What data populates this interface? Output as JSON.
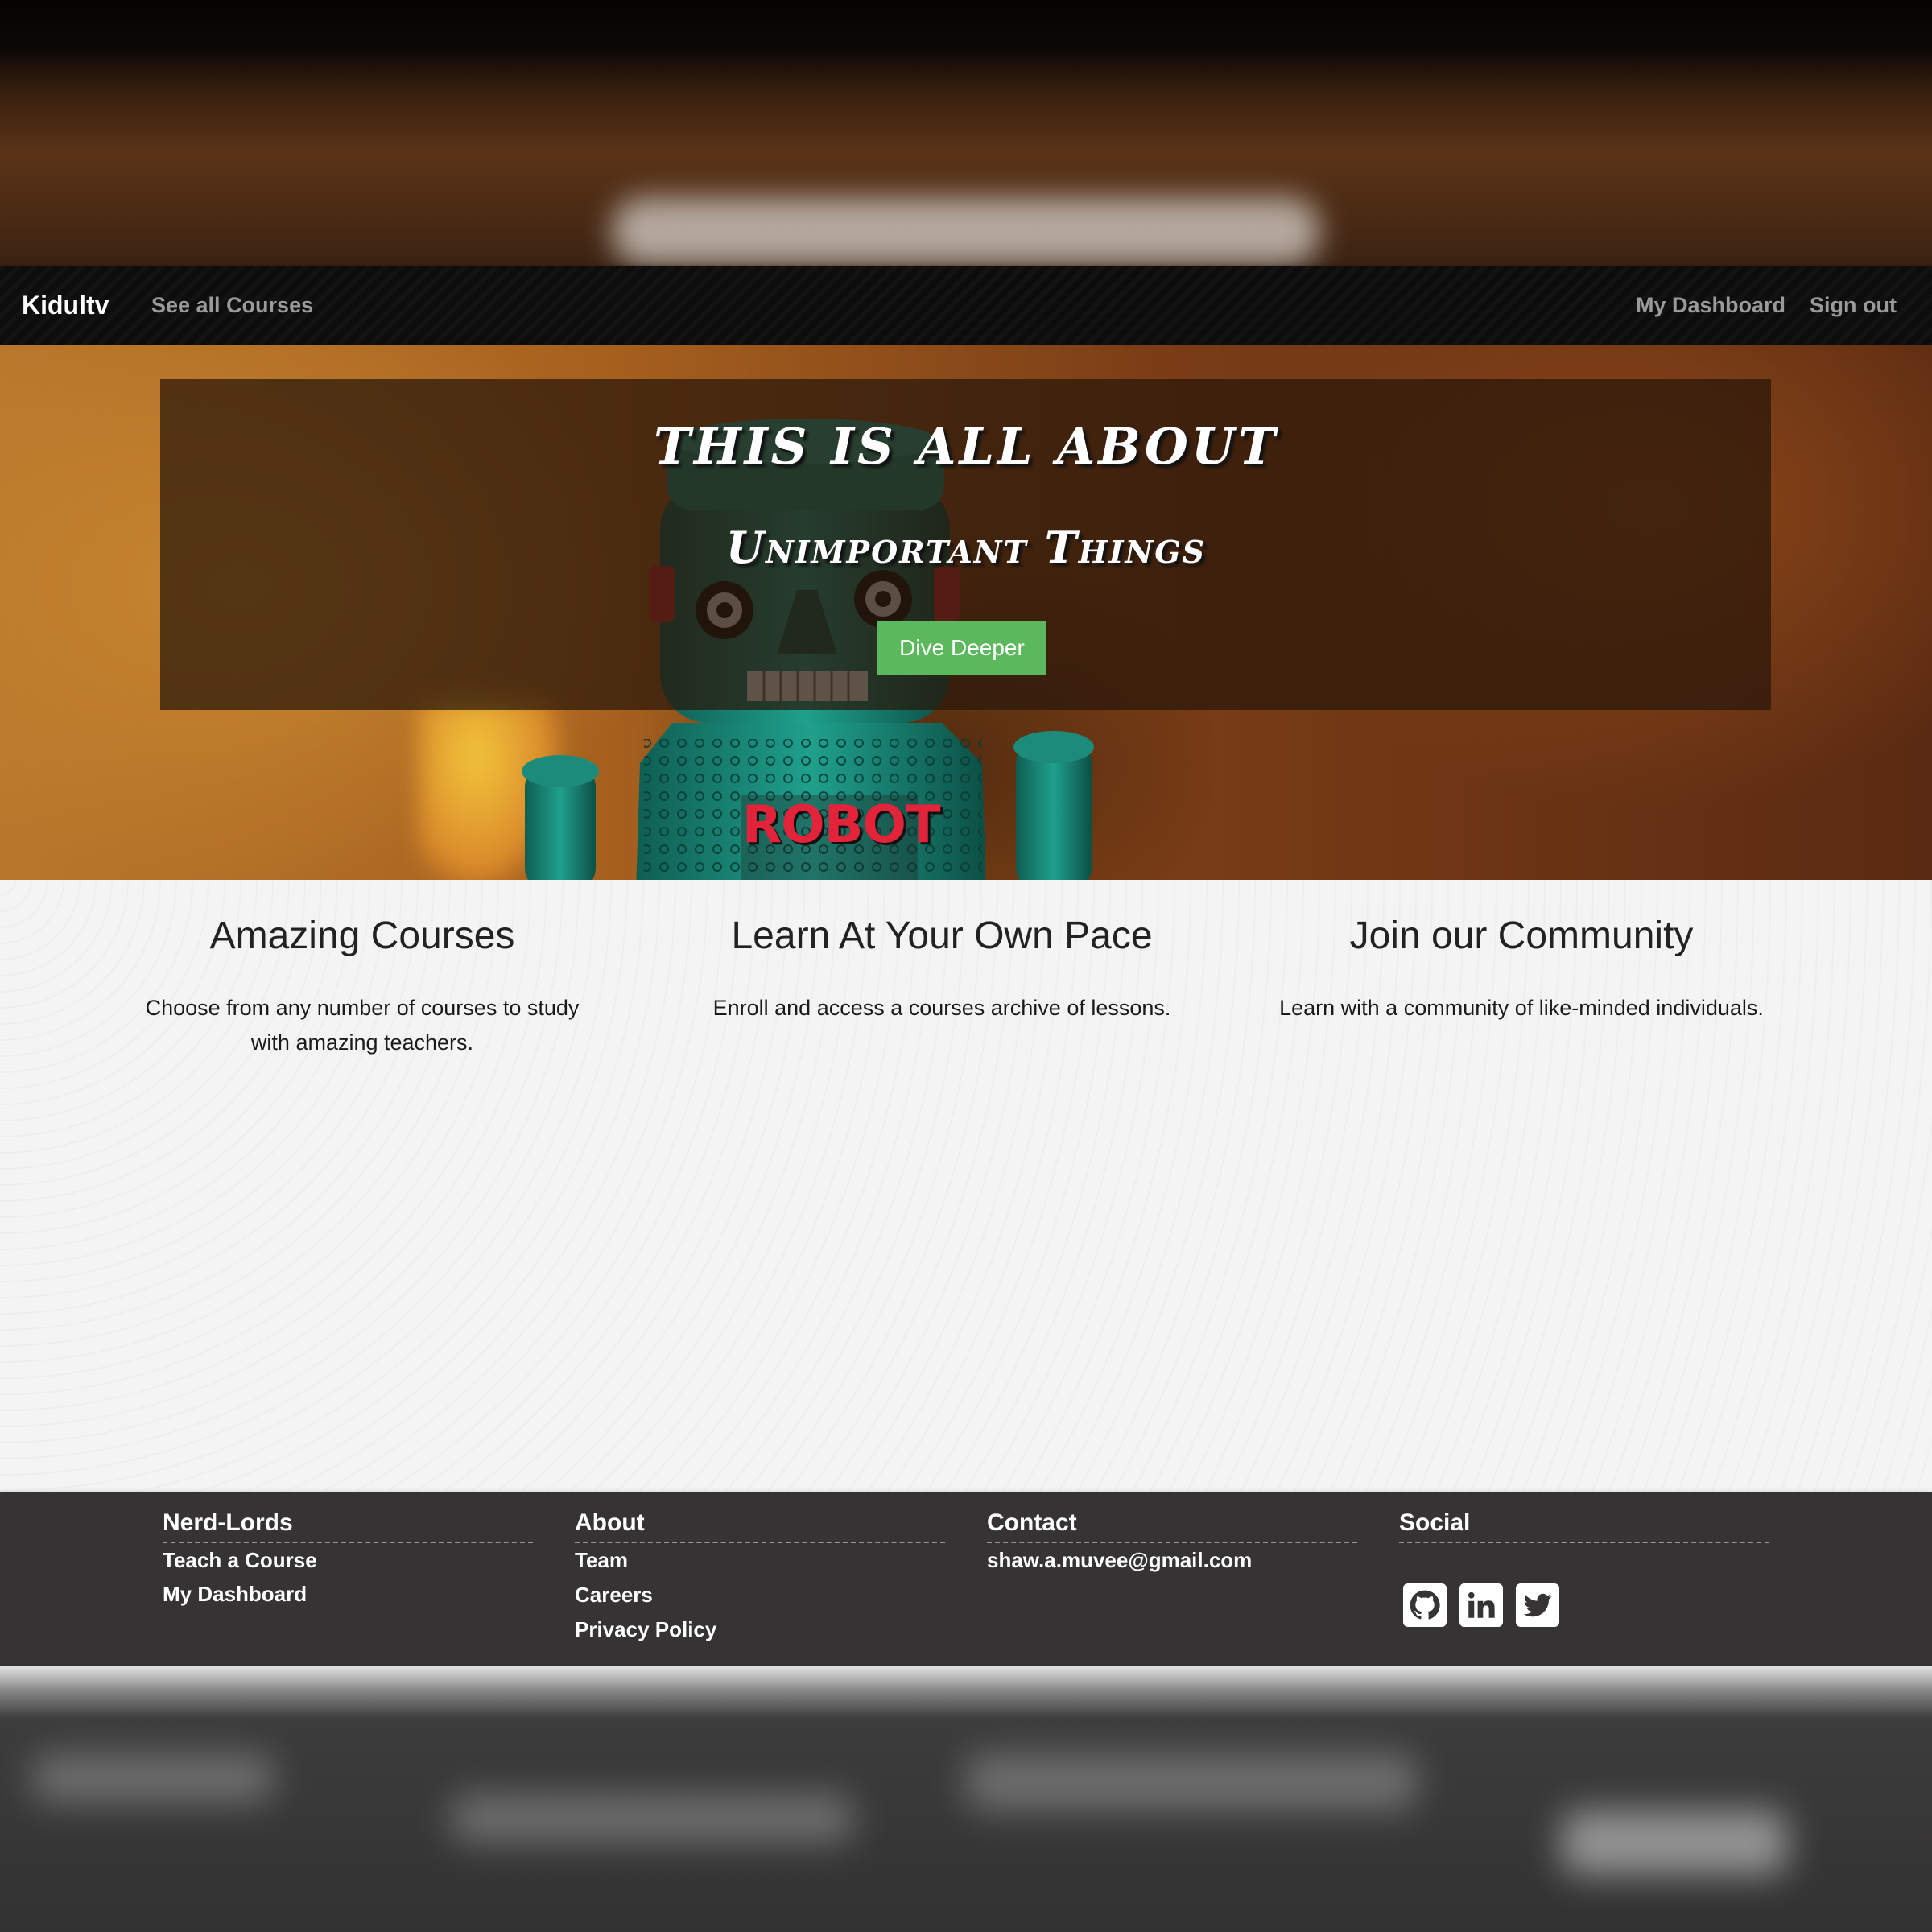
{
  "nav": {
    "brand": "Kidultv",
    "see_all_courses": "See all Courses",
    "my_dashboard": "My Dashboard",
    "sign_out": "Sign out"
  },
  "hero": {
    "title_line1": "THIS IS ALL ABOUT",
    "title_line2": "Unimportant Things",
    "cta_label": "Dive Deeper",
    "robot_text": "ROBOT"
  },
  "features": [
    {
      "heading": "Amazing Courses",
      "text": "Choose from any number of courses to study with amazing teachers."
    },
    {
      "heading": "Learn At Your Own Pace",
      "text": "Enroll and access a courses archive of lessons."
    },
    {
      "heading": "Join our Community",
      "text": "Learn with a community of like-minded individuals."
    }
  ],
  "footer": {
    "nerd_lords": {
      "heading": "Nerd-Lords",
      "links": [
        "Teach a Course",
        "My Dashboard"
      ]
    },
    "about": {
      "heading": "About",
      "links": [
        "Team",
        "Careers",
        "Privacy Policy"
      ]
    },
    "contact": {
      "heading": "Contact",
      "email": "shaw.a.muvee@gmail.com"
    },
    "social": {
      "heading": "Social",
      "icons": [
        "github-icon",
        "linkedin-icon",
        "twitter-icon"
      ]
    }
  },
  "colors": {
    "cta_green": "#5cb85c",
    "navbar_bg": "#0d0d0d",
    "footer_bg": "#353334",
    "features_bg": "#f4f4f4"
  }
}
